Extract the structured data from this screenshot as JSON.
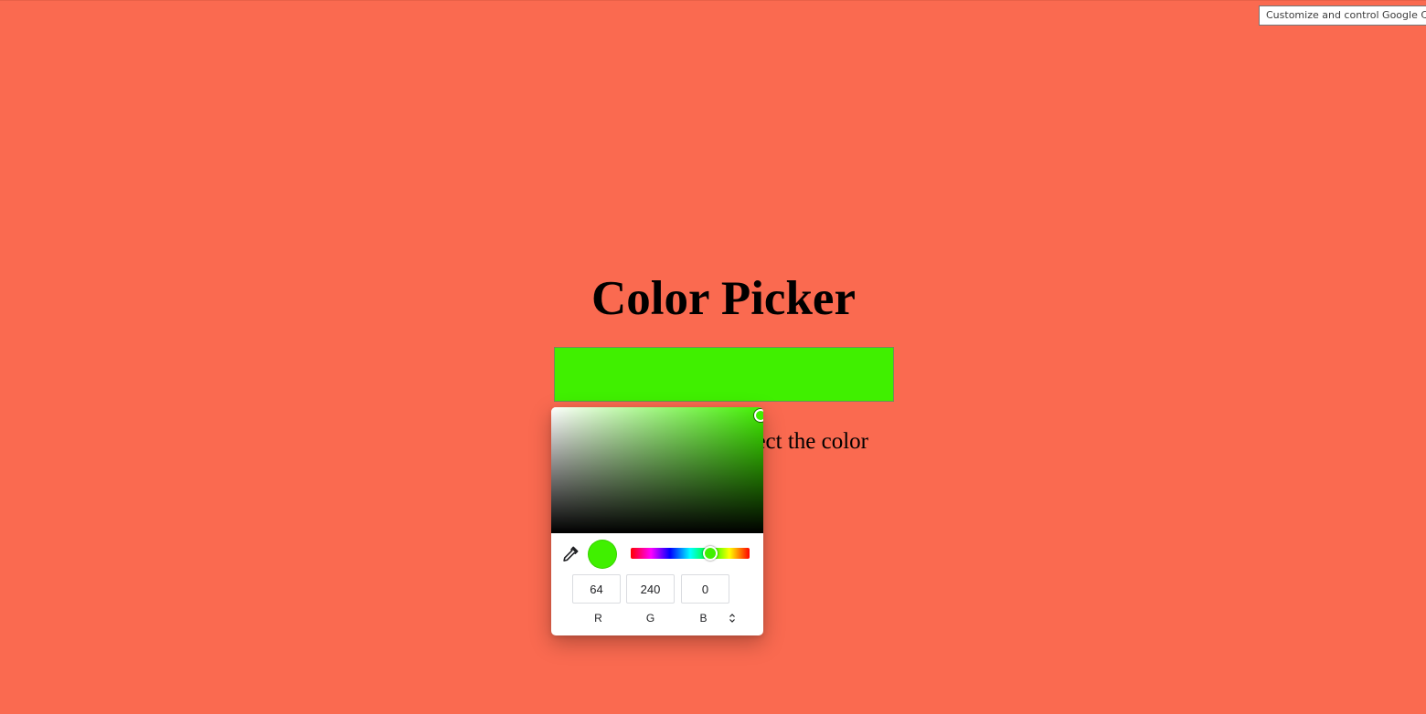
{
  "page": {
    "title": "Color Picker",
    "instruction": "Click to select the color",
    "background_color": "#fa6a50"
  },
  "tooltip": {
    "text": "Customize and control Google Chrome"
  },
  "color_input": {
    "value": "#40f000"
  },
  "color_picker": {
    "selected_color": "#40f000",
    "rgb": {
      "r": "64",
      "g": "240",
      "b": "0"
    },
    "labels": {
      "r": "R",
      "g": "G",
      "b": "B"
    },
    "format_toggle_icon": "up-down-chevron-icon",
    "eyedropper_icon": "eyedropper-icon",
    "hue_position": 0.67
  }
}
